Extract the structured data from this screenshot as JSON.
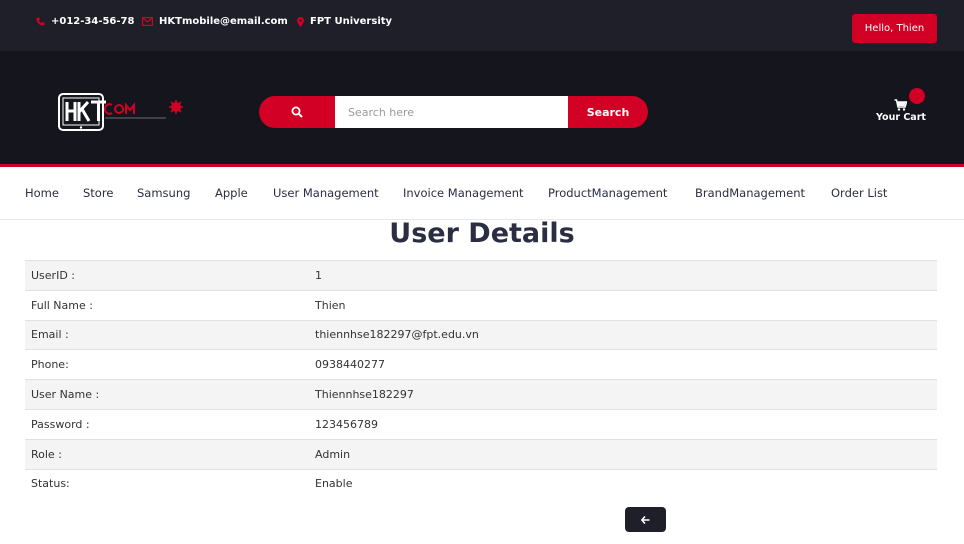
{
  "topbar": {
    "phone": "+012-34-56-78",
    "email": "HKTmobile@email.com",
    "location": "FPT University",
    "greeting": "Hello, Thien"
  },
  "header": {
    "logo_icon": "phone-logo",
    "search_placeholder": "Search here",
    "search_button": "Search",
    "cart_label": "Your Cart"
  },
  "nav": {
    "items": [
      "Home",
      "Store",
      "Samsung",
      "Apple",
      "User Management",
      "Invoice Management",
      "ProductManagement",
      "BrandManagement",
      "Order List"
    ]
  },
  "page": {
    "title": "User Details"
  },
  "details": [
    {
      "label": "UserID :",
      "value": "1"
    },
    {
      "label": "Full Name :",
      "value": "Thien"
    },
    {
      "label": "Email :",
      "value": "thiennhse182297@fpt.edu.vn"
    },
    {
      "label": "Phone:",
      "value": "0938440277"
    },
    {
      "label": "User Name :",
      "value": "Thiennhse182297"
    },
    {
      "label": "Password :",
      "value": "123456789"
    },
    {
      "label": "Role :",
      "value": "Admin"
    },
    {
      "label": "Status:",
      "value": "Enable"
    }
  ],
  "colors": {
    "accent": "#d10024",
    "dark": "#15161d",
    "topbar": "#1e1f29"
  }
}
